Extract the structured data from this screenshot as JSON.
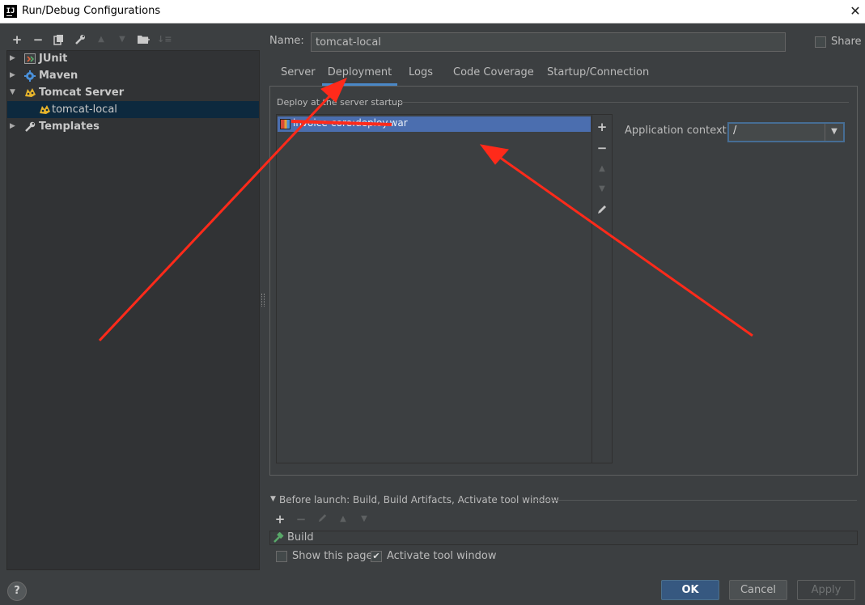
{
  "window": {
    "title": "Run/Debug Configurations",
    "logo_text": "IJ"
  },
  "left_toolbar": [
    "add-icon",
    "remove-icon",
    "copy-icon",
    "wrench-icon",
    "move-up-icon",
    "move-down-icon",
    "folder-icon",
    "sort-icon"
  ],
  "tree": {
    "items": [
      {
        "label": "JUnit",
        "expanded": false
      },
      {
        "label": "Maven",
        "expanded": false
      },
      {
        "label": "Tomcat Server",
        "expanded": true
      },
      {
        "label": "tomcat-local",
        "selected": true
      },
      {
        "label": "Templates",
        "expanded": false
      }
    ]
  },
  "config": {
    "name_label": "Name:",
    "name_value": "tomcat-local",
    "share_label": "Share",
    "share_checked": false
  },
  "tabs": [
    {
      "label": "Server"
    },
    {
      "label": "Deployment",
      "active": true
    },
    {
      "label": "Logs"
    },
    {
      "label": "Code Coverage"
    },
    {
      "label": "Startup/Connection"
    }
  ],
  "deployment": {
    "section_label": "Deploy at the server startup",
    "artifacts": [
      "invoice-core:deploy.war"
    ],
    "context_label": "Application context:",
    "context_value": "/"
  },
  "before_launch": {
    "title": "Before launch: Build, Build Artifacts, Activate tool window",
    "tasks": [
      "Build"
    ],
    "show_page_label": "Show this page",
    "show_page_checked": false,
    "activate_label": "Activate tool window",
    "activate_checked": true
  },
  "footer": {
    "help_label": "?",
    "ok_label": "OK",
    "cancel_label": "Cancel",
    "apply_label": "Apply"
  },
  "colors": {
    "background": "#3c3f41",
    "selection": "#4b6eaf",
    "tab_underline": "#4a88c7",
    "ok_button": "#365880",
    "annotation_arrow": "#ff2a1a"
  }
}
